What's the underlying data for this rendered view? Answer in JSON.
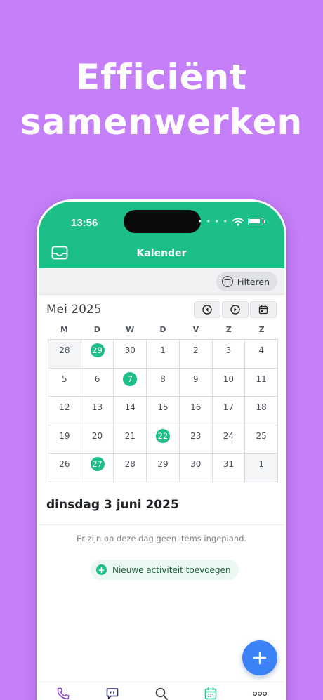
{
  "promo": {
    "line1": "Efficiënt",
    "line2": "samenwerken"
  },
  "status_bar": {
    "time": "13:56"
  },
  "header": {
    "title": "Kalender"
  },
  "filter": {
    "label": "Filteren"
  },
  "calendar": {
    "month_label": "Mei 2025",
    "weekdays": [
      "M",
      "D",
      "W",
      "D",
      "V",
      "Z",
      "Z"
    ],
    "weeks": [
      [
        {
          "d": "28",
          "muted": true
        },
        {
          "d": "29",
          "mark": true
        },
        {
          "d": "30"
        },
        {
          "d": "1"
        },
        {
          "d": "2"
        },
        {
          "d": "3"
        },
        {
          "d": "4"
        }
      ],
      [
        {
          "d": "5"
        },
        {
          "d": "6"
        },
        {
          "d": "7",
          "mark": true
        },
        {
          "d": "8"
        },
        {
          "d": "9"
        },
        {
          "d": "10"
        },
        {
          "d": "11"
        }
      ],
      [
        {
          "d": "12"
        },
        {
          "d": "13"
        },
        {
          "d": "14"
        },
        {
          "d": "15"
        },
        {
          "d": "16"
        },
        {
          "d": "17"
        },
        {
          "d": "18"
        }
      ],
      [
        {
          "d": "19"
        },
        {
          "d": "20"
        },
        {
          "d": "21"
        },
        {
          "d": "22",
          "mark": true
        },
        {
          "d": "23"
        },
        {
          "d": "24"
        },
        {
          "d": "25"
        }
      ],
      [
        {
          "d": "26"
        },
        {
          "d": "27",
          "mark": true
        },
        {
          "d": "28"
        },
        {
          "d": "29"
        },
        {
          "d": "30"
        },
        {
          "d": "31"
        },
        {
          "d": "1",
          "muted": true
        }
      ]
    ]
  },
  "agenda": {
    "date_heading": "dinsdag 3 juni 2025",
    "empty_message": "Er zijn op deze dag geen items ingepland.",
    "add_label": "Nieuwe activiteit toevoegen"
  },
  "colors": {
    "brand": "#1cbf86",
    "background": "#c57ff8",
    "fab": "#3b82f6",
    "tab_active": "#1cbf86"
  },
  "icons": {
    "header": "inbox-icon",
    "nav": [
      "previous-month-icon",
      "next-month-icon",
      "today-calendar-icon"
    ],
    "tabs": [
      "phone-icon",
      "chat-icon",
      "search-icon",
      "calendar-icon",
      "more-icon"
    ]
  }
}
